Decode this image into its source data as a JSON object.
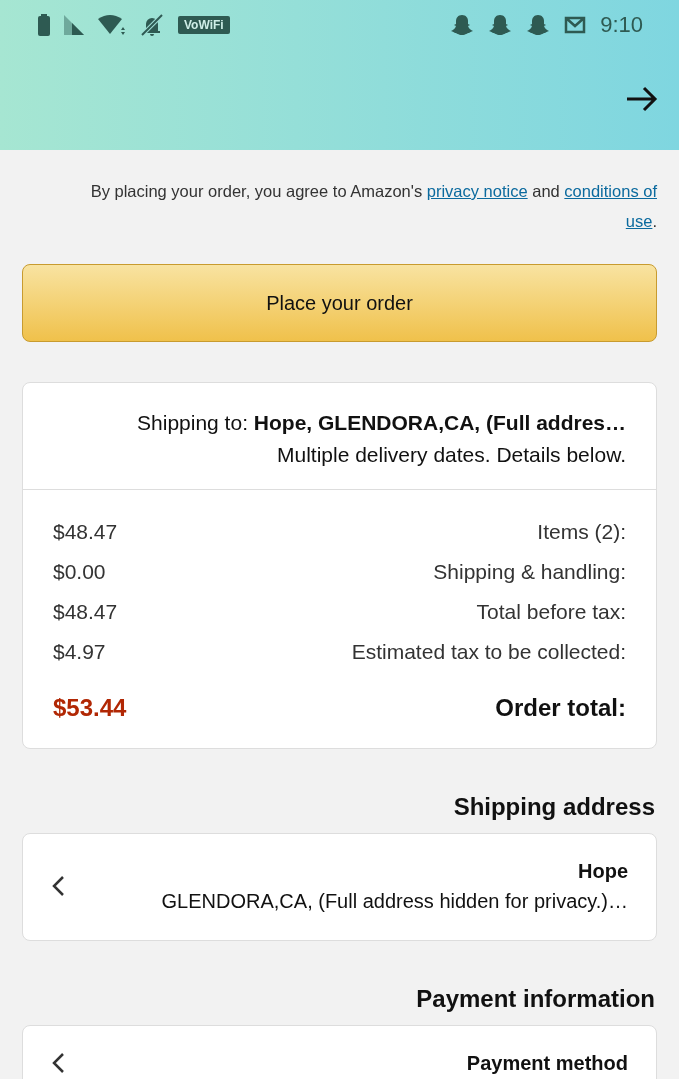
{
  "status_bar": {
    "time": "9:10",
    "badge": "VoWiFi"
  },
  "notice": [
    [
      {
        "text": "By placing your order, you agree to Amazon's ",
        "link": false
      },
      {
        "text": "privacy notice",
        "link": true
      },
      {
        "text": " and ",
        "link": false
      },
      {
        "text": "conditions of",
        "link": true
      }
    ],
    [
      {
        "text": "use",
        "link": true
      },
      {
        "text": ".",
        "link": false
      }
    ]
  ],
  "place_order_button": "Place your order",
  "summary": {
    "shipping_to": "Shipping to: **Hope, GLENDORA,CA, (Full addres…**",
    "delivery_note": "Multiple delivery dates. Details below.",
    "lines": [
      {
        "label": "Items (2):",
        "amount": "$48.47"
      },
      {
        "label": "Shipping & handling:",
        "amount": "$0.00"
      },
      {
        "label": "Total before tax:",
        "amount": "$48.47"
      },
      {
        "label": "Estimated tax to be collected:",
        "amount": "$4.97"
      }
    ],
    "total": {
      "label": "Order total:",
      "amount": "$53.44"
    }
  },
  "sections": [
    {
      "heading": "Shipping address",
      "title": "Hope",
      "subtitle": "GLENDORA,CA, (Full address hidden for privacy.)…"
    },
    {
      "heading": "Payment information",
      "title": "Payment method"
    }
  ]
}
